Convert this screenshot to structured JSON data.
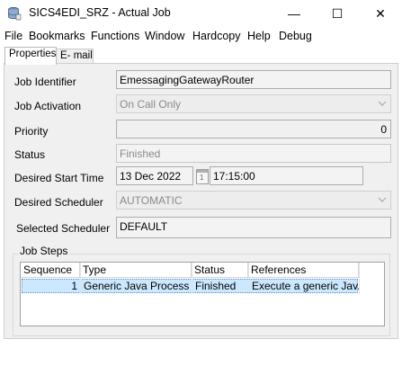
{
  "window": {
    "title": "SICS4EDI_SRZ - Actual Job",
    "minimize_glyph": "—",
    "maximize_glyph": "☐",
    "close_glyph": "✕"
  },
  "menu": [
    "File",
    "Bookmarks",
    "Functions",
    "Window",
    "Hardcopy",
    "Help",
    "Debug"
  ],
  "tabs": [
    "Properties",
    "E- mail"
  ],
  "form": {
    "job_identifier_label": "Job Identifier",
    "job_identifier_value": "EmessagingGatewayRouter",
    "job_activation_label": "Job Activation",
    "job_activation_value": "On Call Only",
    "priority_label": "Priority",
    "priority_value": "0",
    "status_label": "Status",
    "status_value": "Finished",
    "desired_start_time_label": "Desired Start Time",
    "desired_start_date": "13 Dec 2022",
    "desired_start_time": "17:15:00",
    "calendar_icon_text": "1",
    "desired_scheduler_label": "Desired Scheduler",
    "desired_scheduler_value": "AUTOMATIC",
    "selected_scheduler_label": "Selected Scheduler",
    "selected_scheduler_value": "DEFAULT"
  },
  "job_steps": {
    "title": "Job Steps",
    "columns": [
      "Sequence",
      "Type",
      "Status",
      "References"
    ],
    "rows": [
      {
        "sequence": "1",
        "type": "Generic Java Process",
        "status": "Finished",
        "references": "Execute a generic Jav..."
      }
    ]
  },
  "colors": {
    "selected_row": "#cce8ff",
    "panel_bg": "#f0f0f0",
    "disabled_text": "#8a8a8a"
  },
  "icons": {
    "app": "database-icon",
    "dropdown": "chevron-down-icon",
    "calendar": "calendar-icon"
  }
}
